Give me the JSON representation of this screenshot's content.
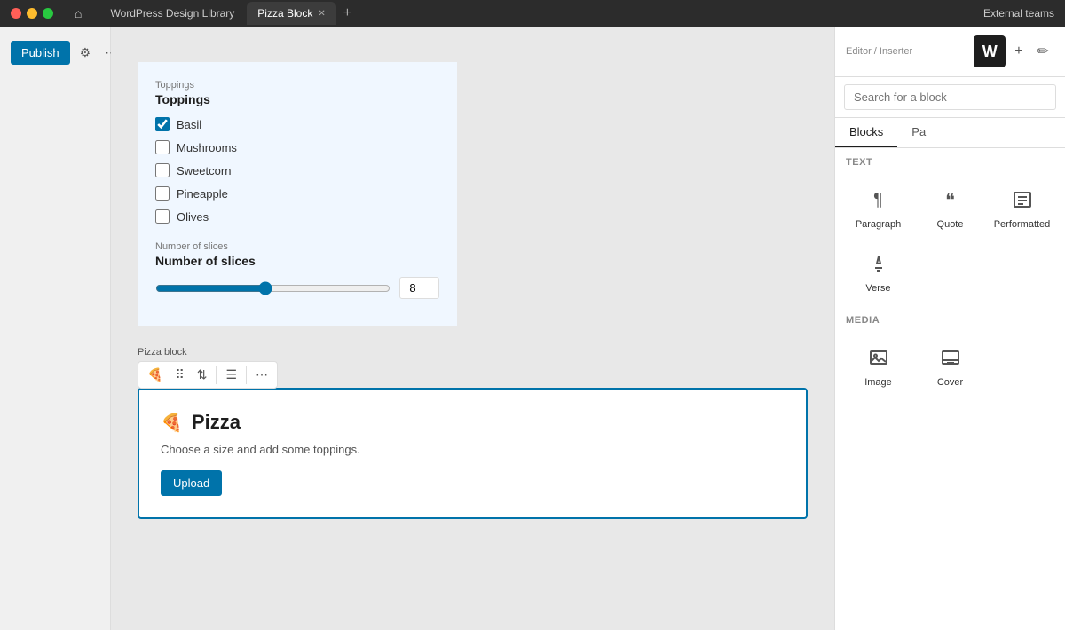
{
  "titlebar": {
    "tabs": [
      {
        "label": "WordPress Design Library",
        "active": false
      },
      {
        "label": "Pizza Block",
        "active": true
      }
    ],
    "add_tab": "+",
    "right_label": "External teams"
  },
  "toolbar": {
    "publish_label": "Publish",
    "settings_icon": "⚙",
    "more_icon": "⋯"
  },
  "toppings": {
    "section_label": "Toppings",
    "section_title": "Toppings",
    "items": [
      {
        "label": "Basil",
        "checked": true
      },
      {
        "label": "Mushrooms",
        "checked": false
      },
      {
        "label": "Sweetcorn",
        "checked": false
      },
      {
        "label": "Pineapple",
        "checked": false
      },
      {
        "label": "Olives",
        "checked": false
      }
    ]
  },
  "slices": {
    "section_label": "Number of slices",
    "section_title": "Number of slices",
    "value": 8,
    "min": 1,
    "max": 16
  },
  "block": {
    "label": "Pizza block",
    "title": "Pizza",
    "description": "Choose a size and add some toppings.",
    "upload_label": "Upload"
  },
  "right_panel": {
    "editor_inserter": "Editor / Inserter",
    "search_placeholder": "Search for a block",
    "tabs": [
      "Blocks",
      "Pa"
    ],
    "active_tab": "Blocks",
    "sections": [
      {
        "label": "TEXT",
        "items": [
          {
            "icon": "¶",
            "label": "Paragraph"
          },
          {
            "icon": "❝",
            "label": "Quote"
          },
          {
            "icon": "▤",
            "label": "Performatted"
          },
          {
            "icon": "✏",
            "label": "Verse"
          }
        ]
      },
      {
        "label": "MEDIA",
        "items": [
          {
            "icon": "🖼",
            "label": "Image"
          },
          {
            "icon": "▣",
            "label": "Cover"
          }
        ]
      }
    ]
  }
}
